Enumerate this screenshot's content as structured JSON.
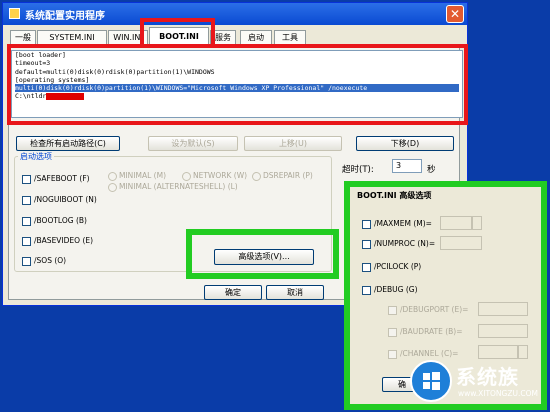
{
  "window": {
    "title": "系统配置实用程序",
    "close_glyph": "✕"
  },
  "tabs": [
    {
      "label": "一般"
    },
    {
      "label": "SYSTEM.INI"
    },
    {
      "label": "WIN.INI"
    },
    {
      "label": "BOOT.INI"
    },
    {
      "label": "服务"
    },
    {
      "label": "启动"
    },
    {
      "label": "工具"
    }
  ],
  "boot_ini": {
    "lines": [
      "[boot loader]",
      "timeout=3",
      "default=multi(0)disk(0)rdisk(0)partition(1)\\WINDOWS",
      "[operating systems]",
      "multi(0)disk(0)rdisk(0)partition(1)\\WINDOWS=\"Microsoft Windows XP Professional\" /noexecute",
      "C:\\ntldr"
    ]
  },
  "buttons": {
    "check_paths": "检查所有启动路径(C)",
    "set_default": "设为默认(S)",
    "move_up": "上移(U)",
    "move_down": "下移(D)",
    "advanced": "高级选项(V)...",
    "ok": "确定",
    "cancel": "取消"
  },
  "boot_options": {
    "legend": "启动选项",
    "checkboxes": [
      {
        "label": "/SAFEBOOT (F)"
      },
      {
        "label": "/NOGUIBOOT (N)"
      },
      {
        "label": "/BOOTLOG (B)"
      },
      {
        "label": "/BASEVIDEO (E)"
      },
      {
        "label": "/SOS (O)"
      }
    ],
    "radios": [
      {
        "label": "MINIMAL (M)"
      },
      {
        "label": "NETWORK (W)"
      },
      {
        "label": "DSREPAIR (P)"
      },
      {
        "label": "MINIMAL (ALTERNATESHELL) (L)"
      }
    ]
  },
  "timeout": {
    "label": "超时(T):",
    "value": "3",
    "unit": "秒"
  },
  "advanced_dialog": {
    "title": "BOOT.INI 高级选项",
    "options": [
      {
        "label": "/MAXMEM (M)="
      },
      {
        "label": "/NUMPROC (N)="
      },
      {
        "label": "/PCILOCK (P)"
      },
      {
        "label": "/DEBUG (G)"
      }
    ],
    "debug_options": [
      {
        "label": "/DEBUGPORT (E)="
      },
      {
        "label": "/BAUDRATE (B)="
      },
      {
        "label": "/CHANNEL (C)="
      }
    ],
    "ok_partial": "确"
  },
  "watermark": {
    "text": "系统族",
    "url": "www.XITONGZU.COM"
  },
  "colors": {
    "highlight_red": "#e8161a",
    "highlight_green": "#22cc22",
    "desktop_blue": "#0a3ca8"
  }
}
